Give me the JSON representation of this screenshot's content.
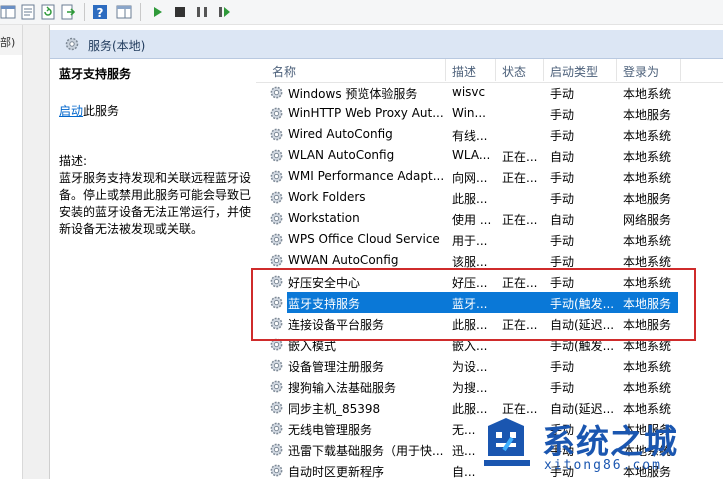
{
  "left_label": "部)",
  "header_title": "服务(本地)",
  "detail": {
    "service_name": "蓝牙支持服务",
    "start_link": "启动",
    "start_suffix": "此服务",
    "desc_label": "描述:",
    "desc_text": "蓝牙服务支持发现和关联远程蓝牙设备。停止或禁用此服务可能会导致已安装的蓝牙设备无法正常运行，并使新设备无法被发现或关联。"
  },
  "columns": {
    "name": "名称",
    "desc": "描述",
    "status": "状态",
    "startup": "启动类型",
    "logon": "登录为"
  },
  "rows": [
    {
      "name": "Windows 预览体验服务",
      "desc": "wisvc",
      "status": "",
      "startup": "手动",
      "logon": "本地系统"
    },
    {
      "name": "WinHTTP Web Proxy Aut...",
      "desc": "Win...",
      "status": "",
      "startup": "手动",
      "logon": "本地服务"
    },
    {
      "name": "Wired AutoConfig",
      "desc": "有线...",
      "status": "",
      "startup": "手动",
      "logon": "本地系统"
    },
    {
      "name": "WLAN AutoConfig",
      "desc": "WLA...",
      "status": "正在...",
      "startup": "自动",
      "logon": "本地系统"
    },
    {
      "name": "WMI Performance Adapt...",
      "desc": "向网...",
      "status": "正在...",
      "startup": "手动",
      "logon": "本地系统"
    },
    {
      "name": "Work Folders",
      "desc": "此服...",
      "status": "",
      "startup": "手动",
      "logon": "本地服务"
    },
    {
      "name": "Workstation",
      "desc": "使用 ...",
      "status": "正在...",
      "startup": "自动",
      "logon": "网络服务"
    },
    {
      "name": "WPS Office Cloud Service",
      "desc": "用于...",
      "status": "",
      "startup": "手动",
      "logon": "本地系统"
    },
    {
      "name": "WWAN AutoConfig",
      "desc": "该服...",
      "status": "",
      "startup": "手动",
      "logon": "本地系统"
    },
    {
      "name": "好压安全中心",
      "desc": "好压...",
      "status": "正在...",
      "startup": "手动",
      "logon": "本地系统"
    },
    {
      "name": "蓝牙支持服务",
      "desc": "蓝牙...",
      "status": "",
      "startup": "手动(触发...",
      "logon": "本地服务"
    },
    {
      "name": "连接设备平台服务",
      "desc": "此服...",
      "status": "正在...",
      "startup": "自动(延迟...",
      "logon": "本地服务"
    },
    {
      "name": "嵌入模式",
      "desc": "嵌入...",
      "status": "",
      "startup": "手动(触发...",
      "logon": "本地系统"
    },
    {
      "name": "设备管理注册服务",
      "desc": "为设...",
      "status": "",
      "startup": "手动",
      "logon": "本地系统"
    },
    {
      "name": "搜狗输入法基础服务",
      "desc": "为搜...",
      "status": "",
      "startup": "手动",
      "logon": "本地系统"
    },
    {
      "name": "同步主机_85398",
      "desc": "此服...",
      "status": "正在...",
      "startup": "自动(延迟...",
      "logon": "本地系统"
    },
    {
      "name": "无线电管理服务",
      "desc": "无...",
      "status": "",
      "startup": "手动",
      "logon": "本地服务"
    },
    {
      "name": "迅雷下载基础服务（用于快...",
      "desc": "迅...",
      "status": "",
      "startup": "手动",
      "logon": "本地系统"
    },
    {
      "name": "自动时区更新程序",
      "desc": "自...",
      "status": "",
      "startup": "手动",
      "logon": "本地服务"
    }
  ],
  "watermark": {
    "title": "系统之城",
    "url": "xitong86.com"
  },
  "colors": {
    "selected": "#0a78d7",
    "highlight_box": "#cf2b2b",
    "header_bg": "#dce6f4",
    "watermark": "#1a56b0"
  }
}
